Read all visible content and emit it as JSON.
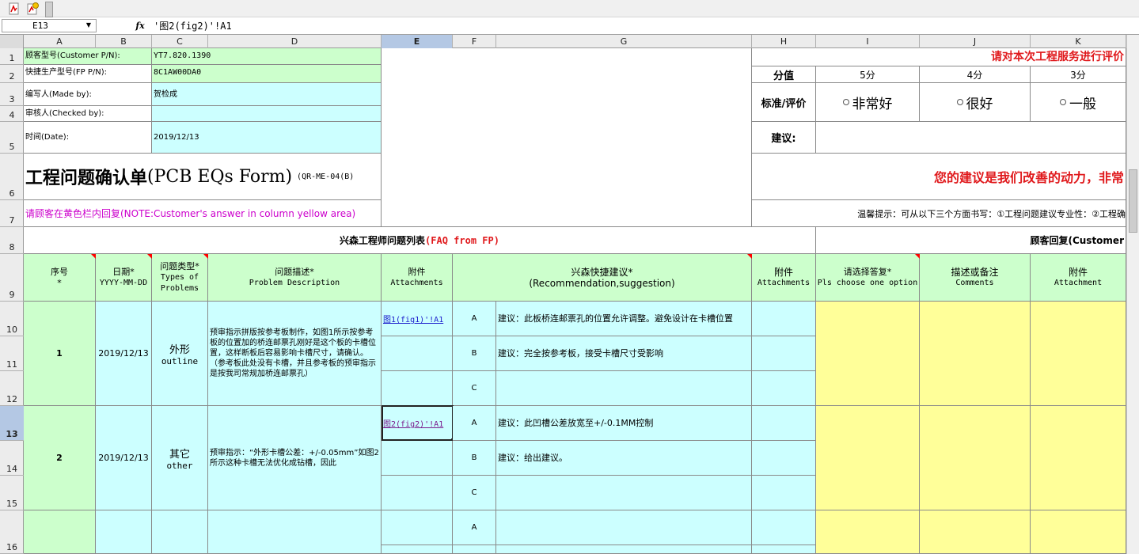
{
  "formula_bar": {
    "name_box": "E13",
    "fx_label": "fx",
    "formula": "'图2(fig2)'!A1"
  },
  "columns": [
    "A",
    "B",
    "C",
    "D",
    "E",
    "F",
    "G",
    "H",
    "I",
    "J",
    "K"
  ],
  "rows": [
    "1",
    "2",
    "3",
    "4",
    "5",
    "6",
    "7",
    "8",
    "9",
    "10",
    "11",
    "12",
    "13",
    "14",
    "15",
    "16"
  ],
  "header_block": {
    "customer_pn_label": "顾客型号(Customer P/N):",
    "customer_pn_value": "YT7.820.1390",
    "fp_pn_label": "快捷生产型号(FP P/N):",
    "fp_pn_value": "8C1AW00DA0",
    "made_by_label": "编写人(Made by):",
    "made_by_value": "贺检成",
    "checked_by_label": "审核人(Checked by):",
    "checked_by_value": "",
    "date_label": "时间(Date):",
    "date_value": "2019/12/13",
    "form_title_cn": "工程问题确认单",
    "form_title_en": "(PCB EQs Form)",
    "form_code": "(QR-ME-04(B)",
    "customer_note": "请顾客在黄色栏内回复(NOTE:Customer's answer in column yellow area)"
  },
  "rating_block": {
    "title": "请对本次工程服务进行评价",
    "score_label": "分值",
    "scores": [
      "5分",
      "4分",
      "3分"
    ],
    "criteria_label": "标准/评价",
    "options": [
      "非常好",
      "很好",
      "一般"
    ],
    "suggestion_label": "建议:",
    "motivation": "您的建议是我们改善的动力，非常",
    "tip": "温馨提示：可从以下三个方面书写：①工程问题建议专业性：②工程确"
  },
  "table": {
    "section_fp": "兴森工程师问题列表",
    "section_fp_en": "(FAQ from FP)",
    "section_customer": "顾客回复(Customer",
    "headers": {
      "no": "序号",
      "no_star": "*",
      "date": "日期*",
      "date_sub": "YYYY-MM-DD",
      "type": "问题类型*",
      "type_sub": "Types of Problems",
      "desc": "问题描述*",
      "desc_sub": "Problem Description",
      "attach": "附件",
      "attach_sub": "Attachments",
      "rec": "兴森快捷建议*",
      "rec_sub": "(Recommendation,suggestion)",
      "attach2": "附件",
      "attach2_sub": "Attachments",
      "choose": "请选择答复*",
      "choose_sub": "Pls choose one option",
      "comments": "描述或备注",
      "comments_sub": "Comments",
      "attach3": "附件",
      "attach3_sub": "Attachment"
    },
    "items": [
      {
        "no": "1",
        "date": "2019/12/13",
        "type_cn": "外形",
        "type_en": "outline",
        "desc": "预审指示拼版按参考板制作，如图1所示按参考板的位置加的桥连邮票孔刚好是这个板的卡槽位置，这样断板后容易影响卡槽尺寸，请确认。（参考板此处没有卡槽，并且参考板的预审指示是按我司常规加桥连邮票孔）",
        "attachment": "图1(fig1)'!A1",
        "options": [
          {
            "letter": "A",
            "text": "建议：此板桥连邮票孔的位置允许调整。避免设计在卡槽位置"
          },
          {
            "letter": "B",
            "text": "建议：完全按参考板，接受卡槽尺寸受影响"
          },
          {
            "letter": "C",
            "text": ""
          }
        ]
      },
      {
        "no": "2",
        "date": "2019/12/13",
        "type_cn": "其它",
        "type_en": "other",
        "desc": "预审指示：“外形卡槽公差：+/-0.05mm”如图2所示这种卡槽无法优化成钻槽，因此",
        "attachment": "图2(fig2)'!A1",
        "options": [
          {
            "letter": "A",
            "text": "建议：此凹槽公差放宽至+/-0.1MM控制"
          },
          {
            "letter": "B",
            "text": "建议：给出建议。"
          },
          {
            "letter": "C",
            "text": ""
          }
        ]
      },
      {
        "no": "",
        "date": "",
        "type_cn": "",
        "type_en": "",
        "desc": "",
        "attachment": "",
        "options": [
          {
            "letter": "A",
            "text": ""
          }
        ]
      }
    ]
  },
  "colors": {
    "green": "#ccffcc",
    "cyan": "#ccffff",
    "yellow": "#ffff99",
    "red": "#e0191c",
    "magenta": "#cc00cc",
    "selected_header": "#b4c8e4"
  }
}
